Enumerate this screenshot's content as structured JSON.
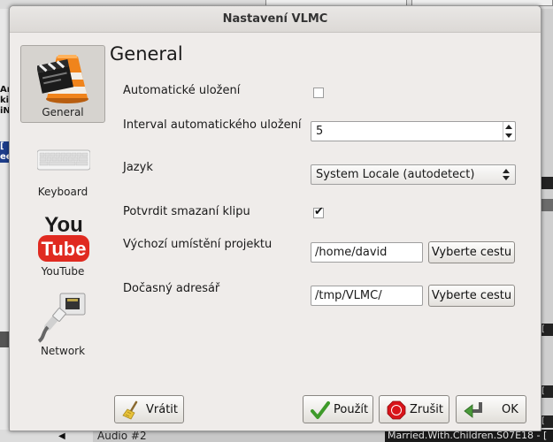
{
  "window": {
    "title": "Nastavení VLMC"
  },
  "background": {
    "left_fragments": [
      "Ar",
      "kip",
      "iN",
      "[",
      "ee"
    ],
    "right_strips": [
      "",
      "",
      "[",
      "[",
      "["
    ],
    "bottom_audio": "Audio #2",
    "bottom_status": "Married.With.Children.S07E18 - ["
  },
  "sidebar": {
    "items": [
      {
        "label": "General",
        "icon": "vlc-cone-clapperboard-icon",
        "selected": true
      },
      {
        "label": "Keyboard",
        "icon": "keyboard-icon",
        "selected": false
      },
      {
        "label": "YouTube",
        "icon": "youtube-logo-icon",
        "selected": false
      },
      {
        "label": "Network",
        "icon": "network-cable-icon",
        "selected": false
      }
    ]
  },
  "page": {
    "title": "General",
    "autosave_label": "Automatické uložení",
    "autosave_checked": false,
    "autosave_interval_label": "Interval automatického uložení",
    "autosave_interval_value": "5",
    "language_label": "Jazyk",
    "language_value": "System Locale (autodetect)",
    "confirm_delete_label": "Potvrdit smazaní klipu",
    "confirm_delete_checked": true,
    "check_mark": "✔",
    "project_dir_label": "Výchozí umístění projektu",
    "project_dir_value": "/home/david",
    "project_dir_button": "Vyberte cestu",
    "temp_dir_label": "Dočasný adresář",
    "temp_dir_value": "/tmp/VLMC/",
    "temp_dir_button": "Vyberte cestu"
  },
  "buttons": {
    "revert": {
      "label": "Vrátit",
      "icon": "broom-icon"
    },
    "apply": {
      "label": "Použít",
      "icon": "checkmark-icon"
    },
    "cancel": {
      "label": "Zrušit",
      "icon": "stop-icon"
    },
    "ok": {
      "label": "OK",
      "icon": "arrow-enter-icon"
    }
  },
  "colors": {
    "dialog_bg": "#efecea",
    "selected_item_bg": "#d6d3cf",
    "youtube_red": "#e02a20",
    "vlc_orange": "#f0841c",
    "apply_green": "#3e9a2a",
    "cancel_red": "#d8141a"
  }
}
